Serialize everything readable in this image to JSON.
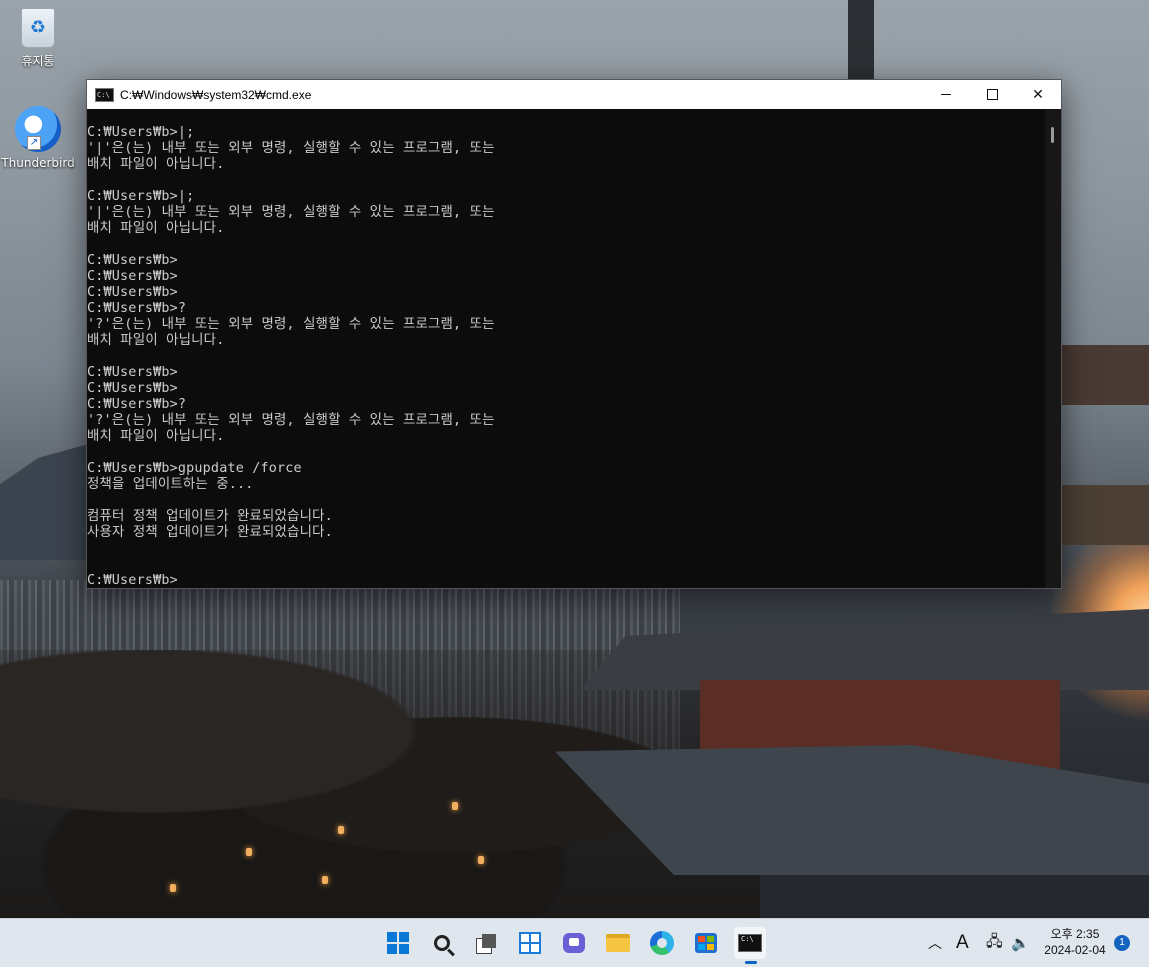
{
  "desktop": {
    "icons": [
      {
        "label": "휴지통"
      },
      {
        "label": "Thunderbird"
      }
    ]
  },
  "window": {
    "title": "C:₩Windows₩system32₩cmd.exe",
    "icon_label": "C:\\",
    "console_lines": [
      "C:₩Users₩b>|;",
      "'|'은(는) 내부 또는 외부 명령, 실행할 수 있는 프로그램, 또는",
      "배치 파일이 아닙니다.",
      "",
      "C:₩Users₩b>|;",
      "'|'은(는) 내부 또는 외부 명령, 실행할 수 있는 프로그램, 또는",
      "배치 파일이 아닙니다.",
      "",
      "C:₩Users₩b>",
      "C:₩Users₩b>",
      "C:₩Users₩b>",
      "C:₩Users₩b>?",
      "'?'은(는) 내부 또는 외부 명령, 실행할 수 있는 프로그램, 또는",
      "배치 파일이 아닙니다.",
      "",
      "C:₩Users₩b>",
      "C:₩Users₩b>",
      "C:₩Users₩b>?",
      "'?'은(는) 내부 또는 외부 명령, 실행할 수 있는 프로그램, 또는",
      "배치 파일이 아닙니다.",
      "",
      "C:₩Users₩b>gpupdate /force",
      "정책을 업데이트하는 중...",
      "",
      "컴퓨터 정책 업데이트가 완료되었습니다.",
      "사용자 정책 업데이트가 완료되었습니다.",
      "",
      "",
      "C:₩Users₩b>"
    ]
  },
  "taskbar": {
    "apps": [
      {
        "name": "start",
        "icon": "windows-logo-icon"
      },
      {
        "name": "search",
        "icon": "search-icon"
      },
      {
        "name": "task-view",
        "icon": "task-view-icon"
      },
      {
        "name": "widgets",
        "icon": "widgets-icon"
      },
      {
        "name": "chat",
        "icon": "chat-icon"
      },
      {
        "name": "file-explorer",
        "icon": "folder-icon"
      },
      {
        "name": "edge",
        "icon": "edge-icon"
      },
      {
        "name": "store",
        "icon": "store-icon"
      },
      {
        "name": "terminal",
        "icon": "cmd-icon",
        "active": true
      }
    ],
    "tray": {
      "ime": "A",
      "time": "오후 2:35",
      "date": "2024-02-04",
      "notification_count": "1"
    }
  },
  "colors": {
    "console_bg": "#0c0c0c",
    "console_fg": "#cccccc",
    "accent": "#0a78d7"
  }
}
